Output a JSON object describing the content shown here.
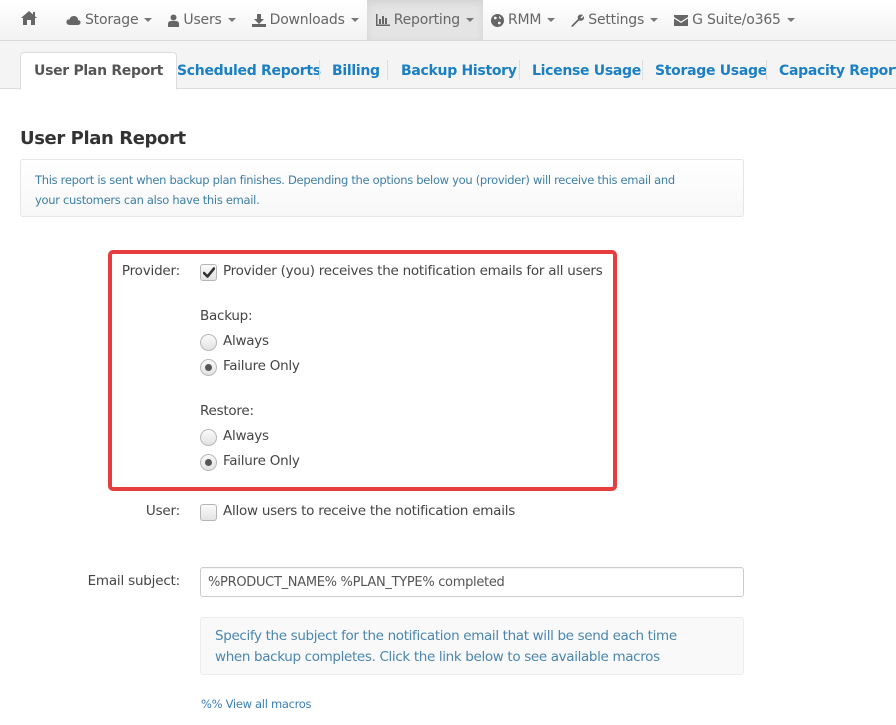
{
  "navbar": {
    "home_icon": "home-icon",
    "items": [
      {
        "label": "Storage",
        "icon": "cloud-icon",
        "active": false
      },
      {
        "label": "Users",
        "icon": "user-icon",
        "active": false
      },
      {
        "label": "Downloads",
        "icon": "download-icon",
        "active": false
      },
      {
        "label": "Reporting",
        "icon": "bar-chart-icon",
        "active": true
      },
      {
        "label": "RMM",
        "icon": "globe-icon",
        "active": false
      },
      {
        "label": "Settings",
        "icon": "wrench-icon",
        "active": false
      },
      {
        "label": "G Suite/o365",
        "icon": "envelope-icon",
        "active": false
      }
    ]
  },
  "tabs": [
    {
      "label": "User Plan Report",
      "active": true
    },
    {
      "label": "Scheduled Reports",
      "active": false
    },
    {
      "label": "Billing",
      "active": false
    },
    {
      "label": "Backup History",
      "active": false
    },
    {
      "label": "License Usage",
      "active": false
    },
    {
      "label": "Storage Usage",
      "active": false
    },
    {
      "label": "Capacity Report",
      "active": false
    }
  ],
  "page": {
    "title": "User Plan Report",
    "info_line1": "This report is sent when backup plan finishes. Depending the options below you (provider) will receive this email and",
    "info_line2": "your customers can also have this email."
  },
  "form": {
    "provider": {
      "label": "Provider:",
      "checkbox_label": "Provider (you) receives the notification emails for all users",
      "checked": true
    },
    "backup": {
      "label": "Backup:",
      "options": [
        {
          "label": "Always",
          "selected": false
        },
        {
          "label": "Failure Only",
          "selected": true
        }
      ]
    },
    "restore": {
      "label": "Restore:",
      "options": [
        {
          "label": "Always",
          "selected": false
        },
        {
          "label": "Failure Only",
          "selected": true
        }
      ]
    },
    "user": {
      "label": "User:",
      "checkbox_label": "Allow users to receive the notification emails",
      "checked": false
    },
    "email_subject": {
      "label": "Email subject:",
      "value": "%PRODUCT_NAME% %PLAN_TYPE% completed"
    },
    "help_line1": "Specify the subject for the notification email that will be send each time",
    "help_line2": "when backup completes. Click the link below to see available macros",
    "macros_link": "%% View all macros"
  },
  "colors": {
    "accent_link": "#1a7fc4",
    "highlight_border": "#e53e3e",
    "info_text": "#3e7fa6"
  }
}
